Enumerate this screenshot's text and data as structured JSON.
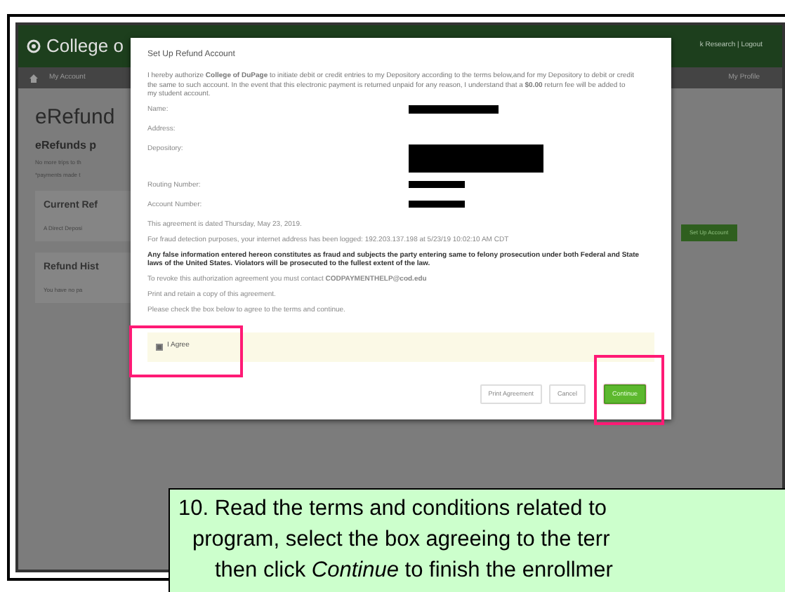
{
  "site": {
    "logo_text": "College o",
    "header_links": "k Research | Logout",
    "nav_item": "My Account",
    "profile_link": "My Profile"
  },
  "page": {
    "title": "eRefund",
    "subtitle": "eRefunds p",
    "lines": [
      "No more trips to th",
      "*payments made t"
    ],
    "cards": [
      {
        "title": "Current Ref",
        "text": "A Direct Deposi"
      },
      {
        "title": "Refund Hist",
        "text": "You have no pa"
      }
    ],
    "setup_button": "Set Up Account"
  },
  "dialog": {
    "title": "Set Up Refund Account",
    "intro": "I hereby authorize **College of DuPage** to initiate debit or credit entries to my Depository according to the terms below,and for my Depository to debit or credit the same to such account. In the event that this electronic payment is returned unpaid for any reason, I understand that a **$0.00** return fee will be added to my student account.",
    "fields": [
      {
        "label": "Name:",
        "redacted": true
      },
      {
        "label": "Address:",
        "redacted": false
      },
      {
        "label": "Depository:",
        "redacted": true
      },
      {
        "label": "Routing Number:",
        "redacted": true
      },
      {
        "label": "Account Number:",
        "redacted": true
      }
    ],
    "statements": [
      {
        "text": "This agreement is dated Thursday, May 23, 2019.",
        "bold": false
      },
      {
        "text": "For fraud detection purposes, your internet address has been logged: 192.203.137.198 at 5/23/19 10:02:10 AM CDT",
        "bold": false
      },
      {
        "text": "Any false information entered hereon constitutes as fraud and subjects the party entering same to felony prosecution under both Federal and State laws of the United States. Violators will be prosecuted to the fullest extent of the law.",
        "bold": true
      },
      {
        "text": "To revoke this authorization agreement you must contact **CODPAYMENTHELP@cod.edu**",
        "bold": false
      },
      {
        "text": "Print and retain a copy of this agreement.",
        "bold": false
      },
      {
        "text": "Please check the box below to agree to the terms and continue.",
        "bold": false
      }
    ],
    "agree": {
      "label": "I Agree",
      "checked": true,
      "highlighted": true
    },
    "buttons": [
      {
        "label": "Print Agreement",
        "kind": "default",
        "highlighted": false
      },
      {
        "label": "Cancel",
        "kind": "default",
        "highlighted": false
      },
      {
        "label": "Continue",
        "kind": "primary",
        "highlighted": true
      }
    ]
  },
  "caption": {
    "lines": [
      "10. Read the terms and conditions related to",
      "program, select the box agreeing to the terr",
      "then click *Continue* to finish the enrollmer"
    ]
  }
}
